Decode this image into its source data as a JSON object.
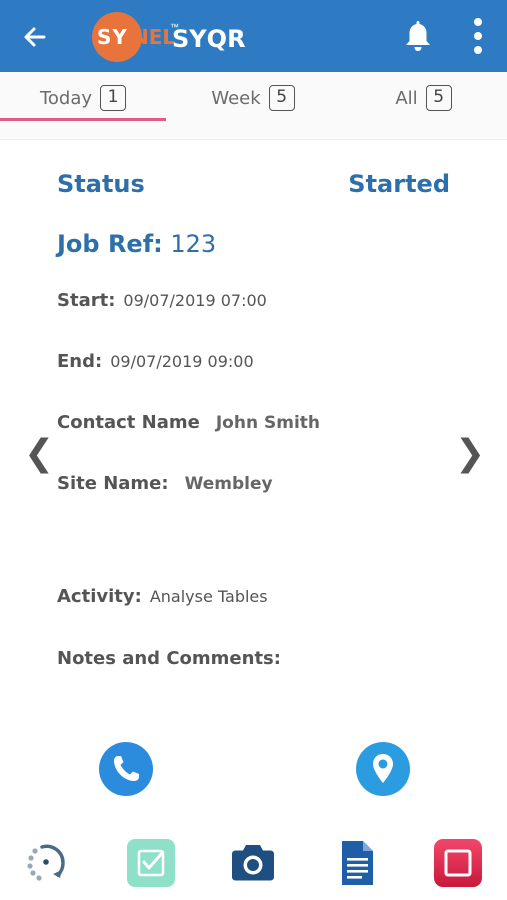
{
  "header": {
    "logo_sy": "SY",
    "logo_nel": "NEL",
    "logo_tm": "™",
    "app_name": "SYQR",
    "back_icon": "arrow-left-icon",
    "bell_icon": "bell-icon",
    "more_icon": "more-vertical-icon"
  },
  "tabs": [
    {
      "label": "Today",
      "count": "1",
      "active": true
    },
    {
      "label": "Week",
      "count": "5",
      "active": false
    },
    {
      "label": "All",
      "count": "5",
      "active": false
    }
  ],
  "job": {
    "status_label": "Status",
    "status_value": "Started",
    "jobref_label": "Job Ref:",
    "jobref_value": "123",
    "start_label": "Start:",
    "start_value": "09/07/2019 07:00",
    "end_label": "End:",
    "end_value": "09/07/2019 09:00",
    "contact_label": "Contact Name",
    "contact_value": "John Smith",
    "site_label": "Site Name:",
    "site_value": "Wembley",
    "activity_label": "Activity:",
    "activity_value": "Analyse Tables",
    "notes_label": "Notes and Comments:"
  },
  "nav": {
    "prev": "❮",
    "next": "❯"
  },
  "actions": {
    "call_icon": "phone-icon",
    "location_icon": "location-pin-icon"
  },
  "toolbar": {
    "items": [
      "sync-icon",
      "checkbox-icon",
      "camera-icon",
      "document-icon",
      "stop-icon"
    ]
  },
  "colors": {
    "header_bg": "#2e7bc4",
    "accent_text": "#2e6faa",
    "logo_orange": "#e8743b",
    "tab_indicator": "#e05a8a",
    "action_blue": "#2b8bdc",
    "check_green": "#8fe0c8",
    "stop_red": "#e0284a"
  }
}
